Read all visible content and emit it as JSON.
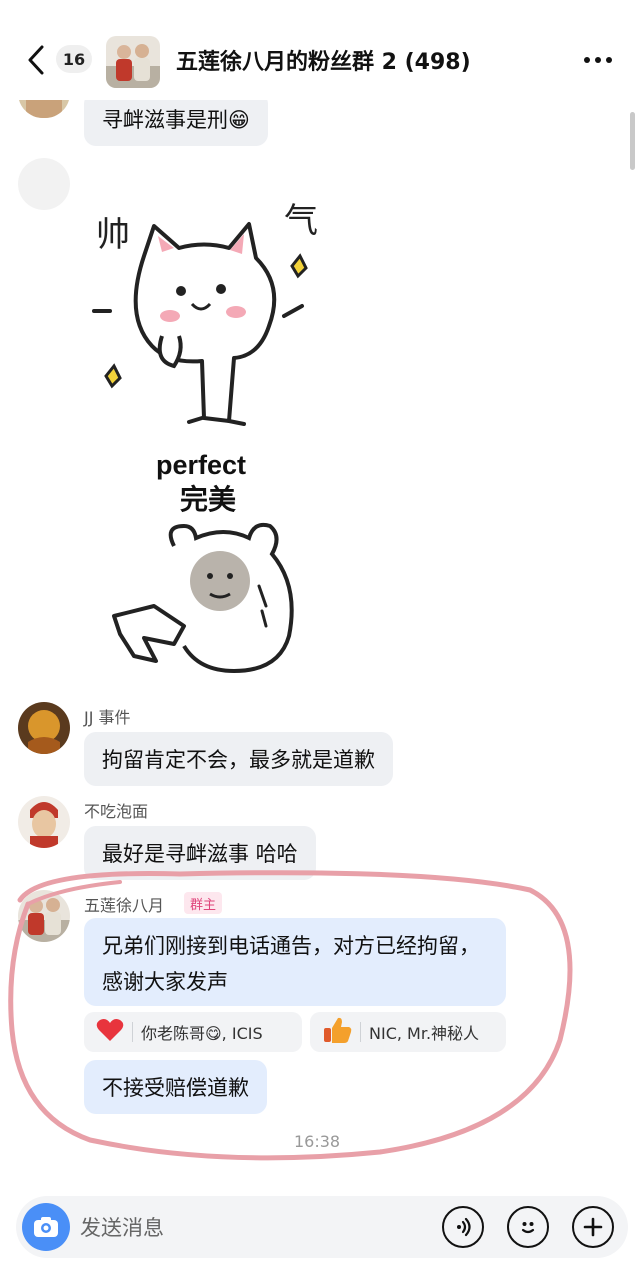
{
  "header": {
    "unread_count": "16",
    "title": "五莲徐八月的粉丝群 2 (498)"
  },
  "messages": {
    "m1_text": "寻衅滋事是刑😁",
    "sticker_text_1": "帅",
    "sticker_text_2": "气",
    "sticker_text_3": "perfect",
    "sticker_text_4": "完美",
    "m3_sender": "JJ 事件",
    "m3_text": "拘留肯定不会，最多就是道歉",
    "m4_sender": "不吃泡面",
    "m4_text": "最好是寻衅滋事 哈哈",
    "m5_sender": "五莲徐八月",
    "m5_badge": "群主",
    "m5_text": "兄弟们刚接到电话通告，对方已经拘留，感谢大家发声",
    "reaction_heart_users": "你老陈哥😋, ICIS",
    "reaction_thumb_users": "NIC, Mr.神秘人",
    "m6_text": "不接受赔偿道歉",
    "timestamp": "16:38"
  },
  "input": {
    "placeholder": "发送消息"
  },
  "colors": {
    "accent": "#4a8ff7",
    "owner_badge": "#e0457b",
    "annotation": "#e8a0a8"
  }
}
